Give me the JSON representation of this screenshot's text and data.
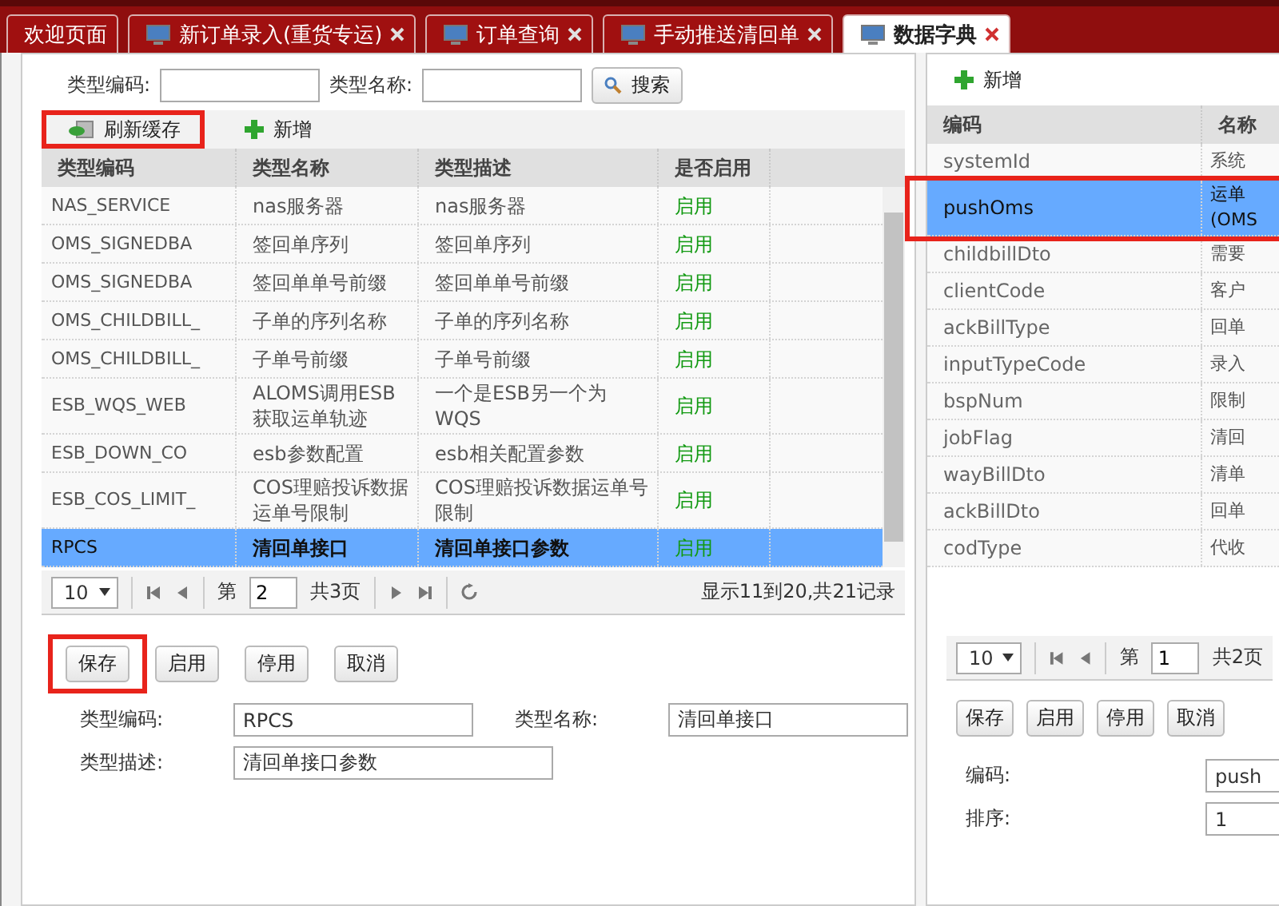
{
  "tabs": [
    {
      "label": "欢迎页面",
      "kind": "plain",
      "selected": false
    },
    {
      "label": "新订单录入(重货专运)",
      "kind": "page",
      "selected": false
    },
    {
      "label": "订单查询",
      "kind": "page",
      "selected": false
    },
    {
      "label": "手动推送清回单",
      "kind": "page",
      "selected": false
    },
    {
      "label": "数据字典",
      "kind": "page",
      "selected": true
    }
  ],
  "left": {
    "search": [
      {
        "label": "类型编码:"
      },
      {
        "label": "类型名称:"
      }
    ],
    "search_button": "搜索",
    "toolbar": [
      {
        "label": "刷新缓存",
        "kind": "refresh",
        "highlighted": true
      },
      {
        "label": "新增",
        "kind": "add",
        "highlighted": false
      }
    ],
    "columns": [
      "类型编码",
      "类型名称",
      "类型描述",
      "是否启用"
    ],
    "rows": [
      {
        "code": "NAS_SERVICE",
        "name": "nas服务器",
        "desc": "nas服务器",
        "status": "启用",
        "selected": false
      },
      {
        "code": "OMS_SIGNEDBA",
        "name": "签回单序列",
        "desc": "签回单序列",
        "status": "启用",
        "selected": false
      },
      {
        "code": "OMS_SIGNEDBA",
        "name": "签回单单号前缀",
        "desc": "签回单单号前缀",
        "status": "启用",
        "selected": false
      },
      {
        "code": "OMS_CHILDBILL_",
        "name": "子单的序列名称",
        "desc": "子单的序列名称",
        "status": "启用",
        "selected": false
      },
      {
        "code": "OMS_CHILDBILL_",
        "name": "子单号前缀",
        "desc": "子单号前缀",
        "status": "启用",
        "selected": false
      },
      {
        "code": "ESB_WQS_WEB",
        "name": "ALOMS调用ESB获取运单轨迹",
        "desc": "一个是ESB另一个为WQS",
        "status": "启用",
        "selected": false
      },
      {
        "code": "ESB_DOWN_CO",
        "name": "esb参数配置",
        "desc": "esb相关配置参数",
        "status": "启用",
        "selected": false
      },
      {
        "code": "ESB_COS_LIMIT_",
        "name": "COS理赔投诉数据运单号限制",
        "desc": "COS理赔投诉数据运单号限制",
        "status": "启用",
        "selected": false
      },
      {
        "code": "RPCS",
        "name": "清回单接口",
        "desc": "清回单接口参数",
        "status": "启用",
        "selected": true
      }
    ],
    "pager": {
      "page_size": "10",
      "prefix": "第",
      "page": "2",
      "suffix": "共3页",
      "summary": "显示11到20,共21记录"
    },
    "buttons": [
      {
        "label": "保存",
        "highlighted": true
      },
      {
        "label": "启用",
        "highlighted": false
      },
      {
        "label": "停用",
        "highlighted": false
      },
      {
        "label": "取消",
        "highlighted": false
      }
    ],
    "fields": [
      {
        "label": "类型编码:",
        "value": "RPCS"
      },
      {
        "label": "类型名称:",
        "value": "清回单接口"
      },
      {
        "label": "类型描述:",
        "value": "清回单接口参数"
      }
    ]
  },
  "right": {
    "toolbar": [
      {
        "label": "新增",
        "kind": "add",
        "highlighted": false
      }
    ],
    "columns": [
      "编码",
      "名称"
    ],
    "rows": [
      {
        "code": "systemId",
        "name": "系统",
        "selected": false,
        "highlighted": false
      },
      {
        "code": "pushOms",
        "name": "运单\n(OMS",
        "selected": true,
        "highlighted": true
      },
      {
        "code": "childbillDto",
        "name": "需要",
        "selected": false,
        "highlighted": false
      },
      {
        "code": "clientCode",
        "name": "客户",
        "selected": false,
        "highlighted": false
      },
      {
        "code": "ackBillType",
        "name": "回单",
        "selected": false,
        "highlighted": false
      },
      {
        "code": "inputTypeCode",
        "name": "录入",
        "selected": false,
        "highlighted": false
      },
      {
        "code": "bspNum",
        "name": "限制",
        "selected": false,
        "highlighted": false
      },
      {
        "code": "jobFlag",
        "name": "清回",
        "selected": false,
        "highlighted": false
      },
      {
        "code": "wayBillDto",
        "name": "清单",
        "selected": false,
        "highlighted": false
      },
      {
        "code": "ackBillDto",
        "name": "回单",
        "selected": false,
        "highlighted": false
      },
      {
        "code": "codType",
        "name": "代收",
        "selected": false,
        "highlighted": false
      }
    ],
    "pager": {
      "page_size": "10",
      "prefix": "第",
      "page": "1",
      "suffix": "共2页"
    },
    "buttons": [
      {
        "label": "保存",
        "highlighted": false
      },
      {
        "label": "启用",
        "highlighted": false
      },
      {
        "label": "停用",
        "highlighted": false
      },
      {
        "label": "取消",
        "highlighted": false
      }
    ],
    "fields": [
      {
        "label": "编码:",
        "value": "push"
      },
      {
        "label": "排序:",
        "value": "1"
      }
    ]
  }
}
